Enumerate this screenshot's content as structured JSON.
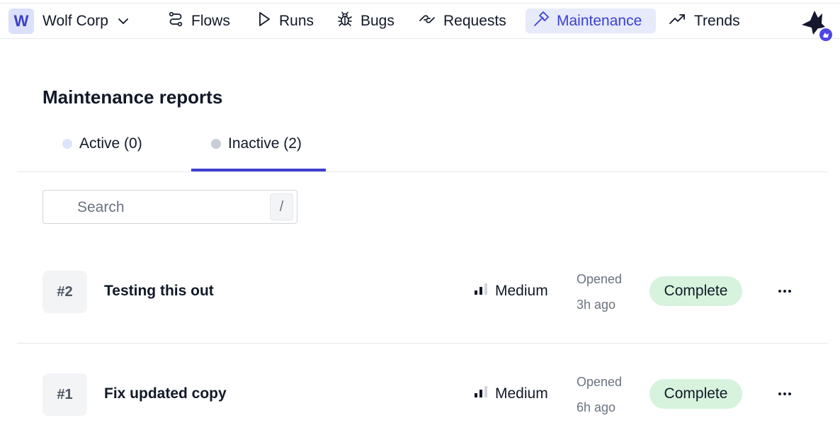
{
  "workspace": {
    "initial": "W",
    "name": "Wolf Corp"
  },
  "nav": {
    "items": [
      {
        "label": "Flows",
        "icon": "flows-icon"
      },
      {
        "label": "Runs",
        "icon": "play-icon"
      },
      {
        "label": "Bugs",
        "icon": "bug-icon"
      },
      {
        "label": "Requests",
        "icon": "requests-icon"
      },
      {
        "label": "Maintenance",
        "icon": "hammer-icon",
        "active": true
      },
      {
        "label": "Trends",
        "icon": "trend-icon"
      }
    ]
  },
  "page": {
    "title": "Maintenance reports"
  },
  "tabs": [
    {
      "label": "Active (0)",
      "selected": false
    },
    {
      "label": "Inactive (2)",
      "selected": true
    }
  ],
  "search": {
    "placeholder": "Search",
    "shortcut": "/"
  },
  "reports": [
    {
      "number": "#2",
      "title": "Testing this out",
      "priority": "Medium",
      "opened_label": "Opened",
      "opened_time": "3h ago",
      "status": "Complete"
    },
    {
      "number": "#1",
      "title": "Fix updated copy",
      "priority": "Medium",
      "opened_label": "Opened",
      "opened_time": "6h ago",
      "status": "Complete"
    }
  ],
  "colors": {
    "accent": "#3f3fd0",
    "active_nav_bg": "#e6eafb",
    "status_complete_bg": "#d7f3dd",
    "badge_bg": "#f3f4f6"
  }
}
